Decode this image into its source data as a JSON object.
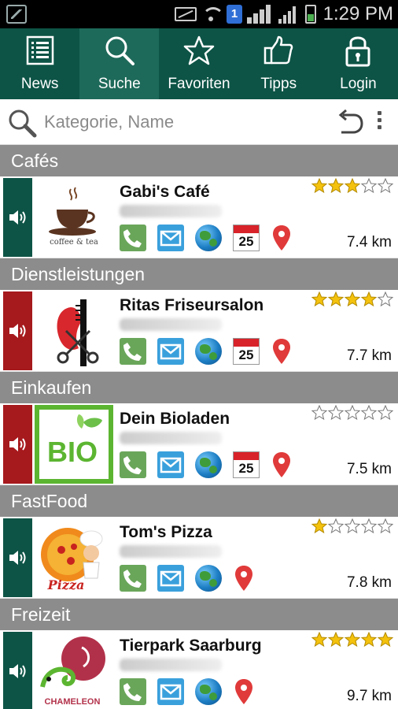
{
  "status_bar": {
    "time": "1:29 PM",
    "sim_number": "1"
  },
  "nav": {
    "tabs": [
      {
        "label": "News",
        "icon": "list-icon",
        "active": false
      },
      {
        "label": "Suche",
        "icon": "search-icon",
        "active": true
      },
      {
        "label": "Favoriten",
        "icon": "star-icon",
        "active": false
      },
      {
        "label": "Tipps",
        "icon": "thumbs-up-icon",
        "active": false
      },
      {
        "label": "Login",
        "icon": "lock-icon",
        "active": false
      }
    ]
  },
  "search": {
    "placeholder": "Kategorie, Name"
  },
  "colors": {
    "nav_bg": "#0d5446",
    "nav_active": "#1e6a5a",
    "category_bg": "#8c8c8c",
    "speaker_green": "#0d5446",
    "speaker_red": "#a6191d",
    "star_gold": "#f4c20d"
  },
  "categories": [
    {
      "name": "Cafés",
      "entry": {
        "title": "Gabi's Café",
        "rating": 3,
        "max_rating": 5,
        "distance": "7.4 km",
        "speaker": "green",
        "logo": "coffee-tea-logo",
        "logo_text": "coffee & tea",
        "calendar": "25"
      }
    },
    {
      "name": "Dienstleistungen",
      "entry": {
        "title": "Ritas Friseursalon",
        "rating": 4,
        "max_rating": 5,
        "distance": "7.7 km",
        "speaker": "red",
        "logo": "hair-salon-logo",
        "calendar": "25"
      }
    },
    {
      "name": "Einkaufen",
      "entry": {
        "title": "Dein Bioladen",
        "rating": 0,
        "max_rating": 5,
        "distance": "7.5 km",
        "speaker": "red",
        "logo": "bio-logo",
        "logo_text": "BIO",
        "calendar": "25"
      }
    },
    {
      "name": "FastFood",
      "entry": {
        "title": "Tom's Pizza",
        "rating": 1,
        "max_rating": 5,
        "distance": "7.8 km",
        "speaker": "green",
        "logo": "pizza-chef-logo",
        "logo_text": "Pizza",
        "calendar": null
      }
    },
    {
      "name": "Freizeit",
      "entry": {
        "title": "Tierpark Saarburg",
        "rating": 5,
        "max_rating": 5,
        "distance": "9.7 km",
        "speaker": "green",
        "logo": "chameleon-logo",
        "logo_text": "CHAMELEON",
        "calendar": null
      }
    }
  ]
}
